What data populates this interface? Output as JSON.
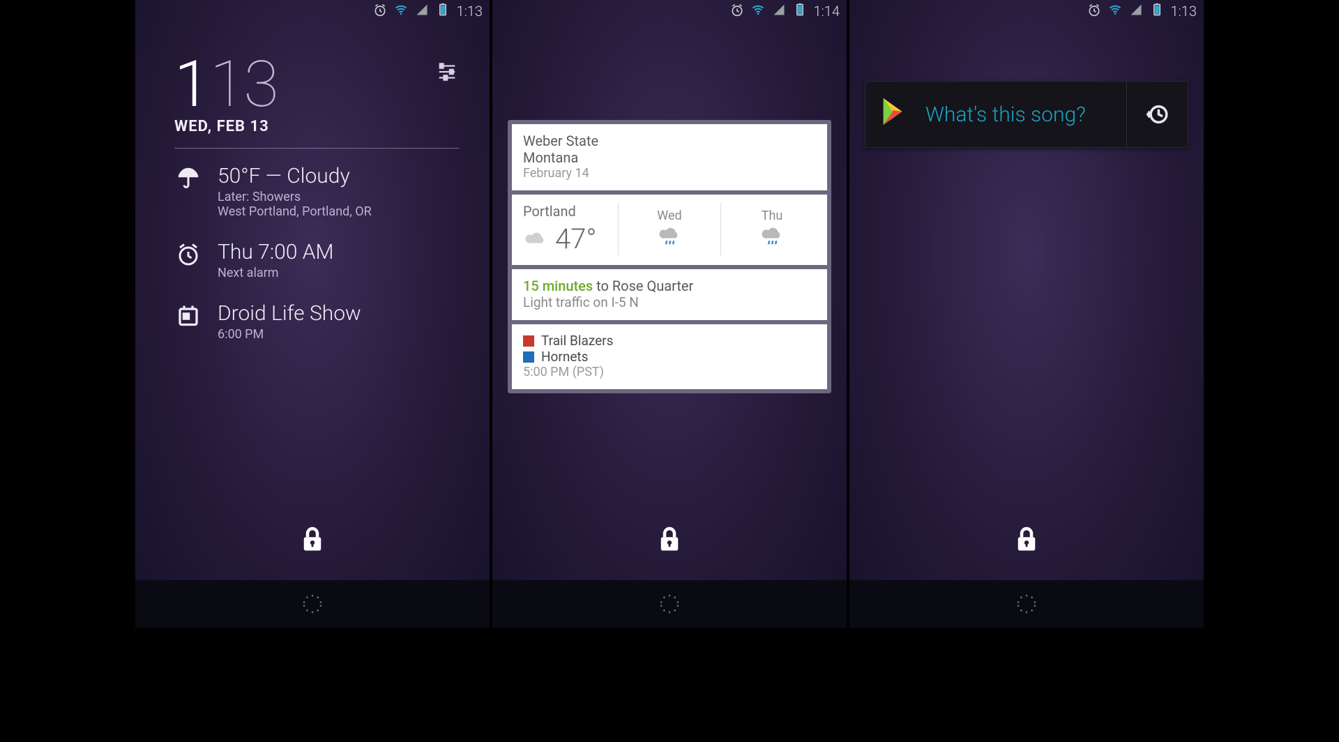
{
  "screens": [
    {
      "status_time": "1:13",
      "dashclock": {
        "hour": "1",
        "minute": "13",
        "date": "WED, FEB 13",
        "extensions": [
          {
            "icon": "umbrella",
            "line1": "50°F — Cloudy",
            "line2": "Later: Showers",
            "line3": "West Portland, Portland, OR"
          },
          {
            "icon": "alarm",
            "line1": "Thu 7:00 AM",
            "line2": "Next alarm",
            "line3": ""
          },
          {
            "icon": "calendar",
            "line1": "Droid Life Show",
            "line2": "6:00 PM",
            "line3": ""
          }
        ]
      }
    },
    {
      "status_time": "1:14",
      "google_now": {
        "event": {
          "title": "Weber State",
          "sub": "Montana",
          "date": "February 14"
        },
        "weather": {
          "city": "Portland",
          "temp": "47°",
          "cols": [
            {
              "label": "Wed",
              "icon": "rain"
            },
            {
              "label": "Thu",
              "icon": "rain"
            }
          ]
        },
        "traffic": {
          "duration": "15 minutes",
          "dest": " to Rose Quarter",
          "detail": "Light traffic on I-5 N"
        },
        "sports": {
          "team_a": "Trail Blazers",
          "team_b": "Hornets",
          "time": "5:00 PM (PST)"
        }
      }
    },
    {
      "status_time": "1:13",
      "sound_search": {
        "label": "What's this song?"
      }
    }
  ],
  "icons": {
    "alarm": "alarm-icon",
    "wifi": "wifi-icon",
    "signal": "signal-icon",
    "battery": "battery-icon",
    "lock": "lock-icon",
    "settings": "settings-sliders-icon",
    "umbrella": "umbrella-icon",
    "calendar": "calendar-icon",
    "history": "history-icon",
    "play": "google-play-icon"
  }
}
